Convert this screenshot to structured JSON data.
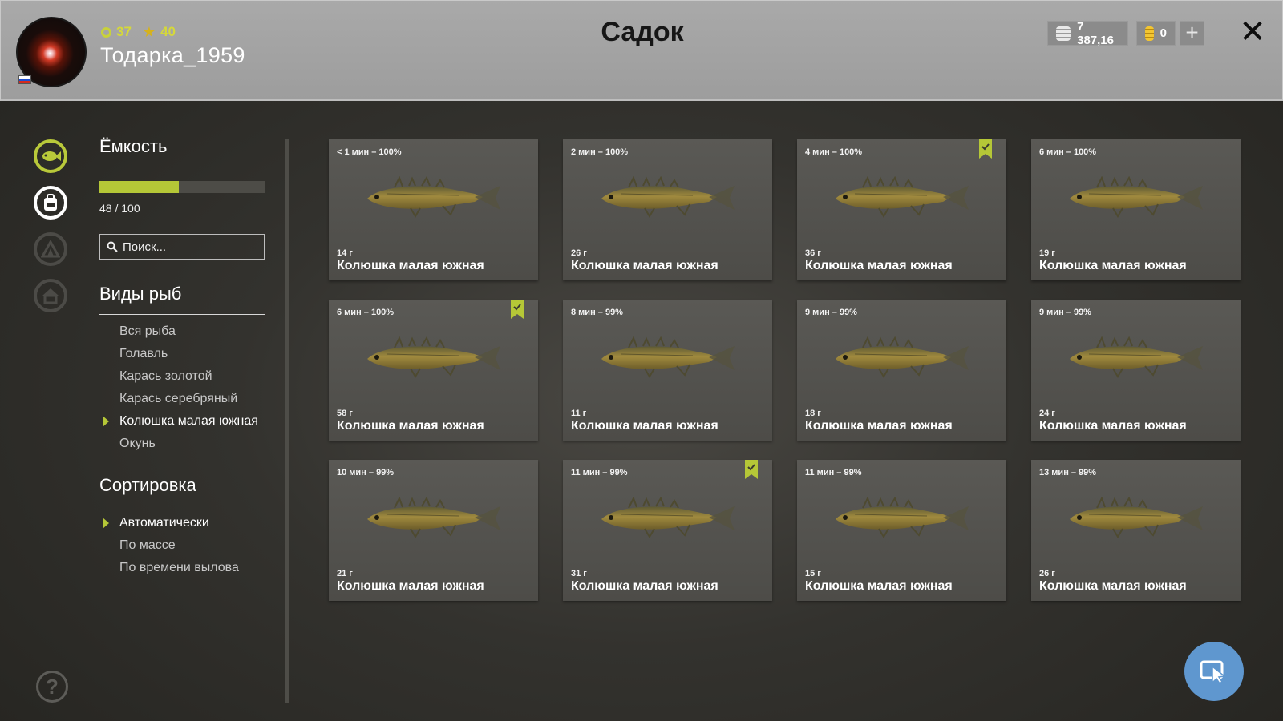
{
  "header": {
    "title": "Садок",
    "username": "Тодарка_1959",
    "level": "37",
    "rank": "40",
    "silver": "7 387,16",
    "gold": "0",
    "plus_label": "+",
    "close_label": "✕"
  },
  "capacity": {
    "title": "Ёмкость",
    "current": 48,
    "max": 100,
    "text": "48 / 100"
  },
  "search": {
    "placeholder": "Поиск..."
  },
  "species": {
    "title": "Виды рыб",
    "items": [
      {
        "label": "Вся рыба",
        "active": false
      },
      {
        "label": "Голавль",
        "active": false
      },
      {
        "label": "Карась золотой",
        "active": false
      },
      {
        "label": "Карась серебряный",
        "active": false
      },
      {
        "label": "Колюшка малая южная",
        "active": true
      },
      {
        "label": "Окунь",
        "active": false
      }
    ]
  },
  "sorting": {
    "title": "Сортировка",
    "items": [
      {
        "label": "Автоматически",
        "active": true
      },
      {
        "label": "По массе",
        "active": false
      },
      {
        "label": "По времени вылова",
        "active": false
      }
    ]
  },
  "fish": [
    {
      "time": "< 1 мин – 100%",
      "weight": "14 г",
      "name": "Колюшка малая южная",
      "bookmarked": false
    },
    {
      "time": "2 мин – 100%",
      "weight": "26 г",
      "name": "Колюшка малая южная",
      "bookmarked": false
    },
    {
      "time": "4 мин – 100%",
      "weight": "36 г",
      "name": "Колюшка малая южная",
      "bookmarked": true
    },
    {
      "time": "6 мин – 100%",
      "weight": "19 г",
      "name": "Колюшка малая южная",
      "bookmarked": false
    },
    {
      "time": "6 мин – 100%",
      "weight": "58 г",
      "name": "Колюшка малая южная",
      "bookmarked": true
    },
    {
      "time": "8 мин – 99%",
      "weight": "11 г",
      "name": "Колюшка малая южная",
      "bookmarked": false
    },
    {
      "time": "9 мин – 99%",
      "weight": "18 г",
      "name": "Колюшка малая южная",
      "bookmarked": false
    },
    {
      "time": "9 мин – 99%",
      "weight": "24 г",
      "name": "Колюшка малая южная",
      "bookmarked": false
    },
    {
      "time": "10 мин – 99%",
      "weight": "21 г",
      "name": "Колюшка малая южная",
      "bookmarked": false
    },
    {
      "time": "11 мин – 99%",
      "weight": "31 г",
      "name": "Колюшка малая южная",
      "bookmarked": true
    },
    {
      "time": "11 мин – 99%",
      "weight": "15 г",
      "name": "Колюшка малая южная",
      "bookmarked": false
    },
    {
      "time": "13 мин – 99%",
      "weight": "26 г",
      "name": "Колюшка малая южная",
      "bookmarked": false
    }
  ],
  "help_label": "?",
  "colors": {
    "accent": "#b5c737",
    "header_bg": "#a9a9a9",
    "card_bg": "#55544f",
    "action_button": "#5f97cf"
  },
  "icons": {
    "rail": [
      "fish-icon",
      "backpack-icon",
      "tent-icon",
      "home-icon"
    ],
    "action": "cursor-select-icon"
  }
}
